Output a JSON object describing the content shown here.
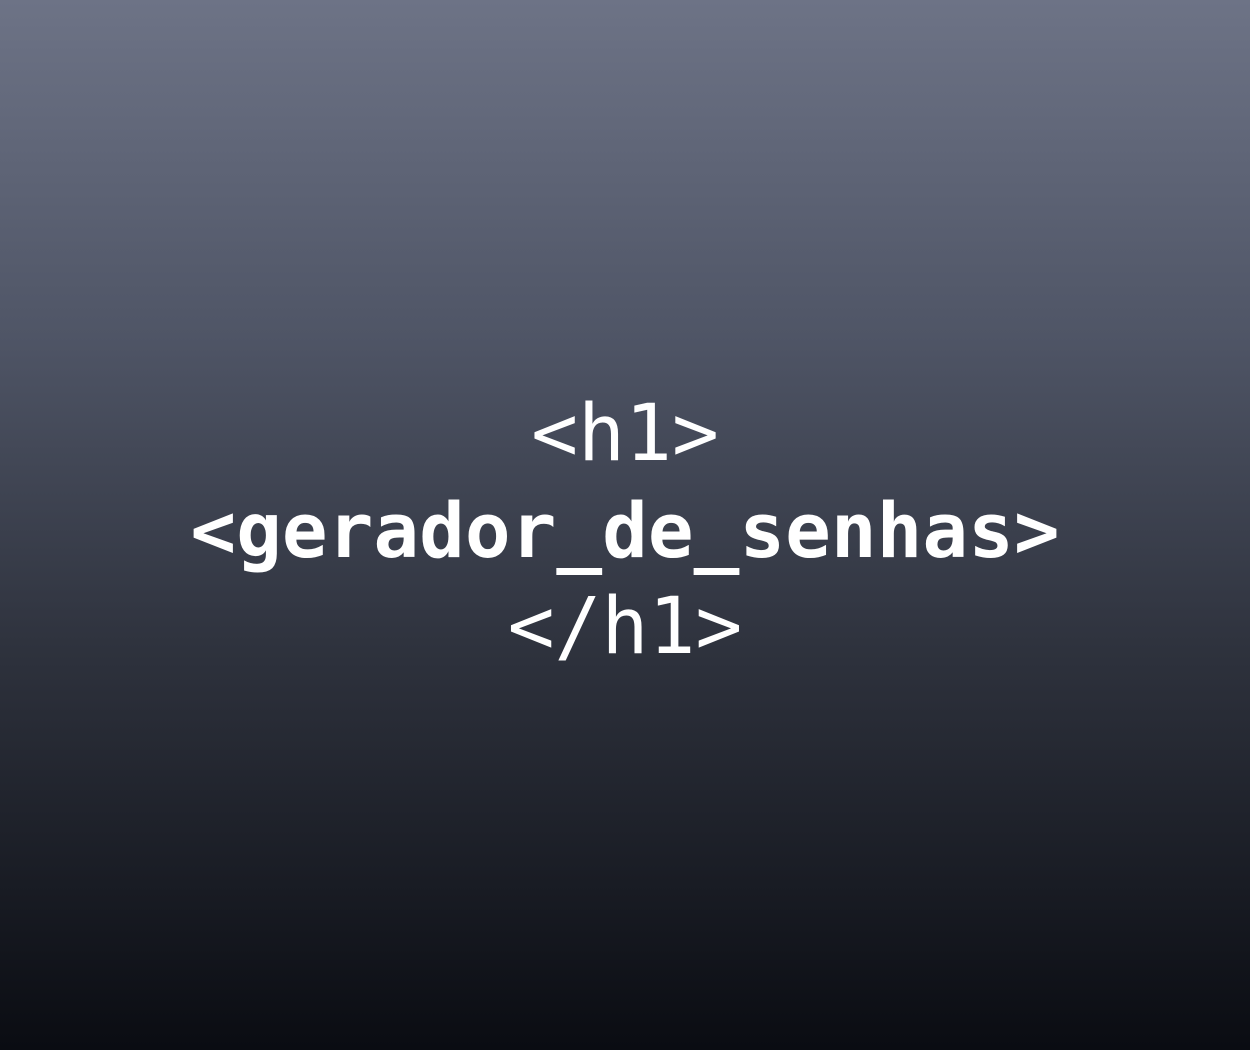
{
  "lines": {
    "open_tag": "<h1>",
    "title": "<gerador_de_senhas>",
    "close_tag": "</h1>"
  },
  "colors": {
    "text": "#ffffff",
    "background_top": "#6d7386",
    "background_bottom": "#0a0c12"
  }
}
